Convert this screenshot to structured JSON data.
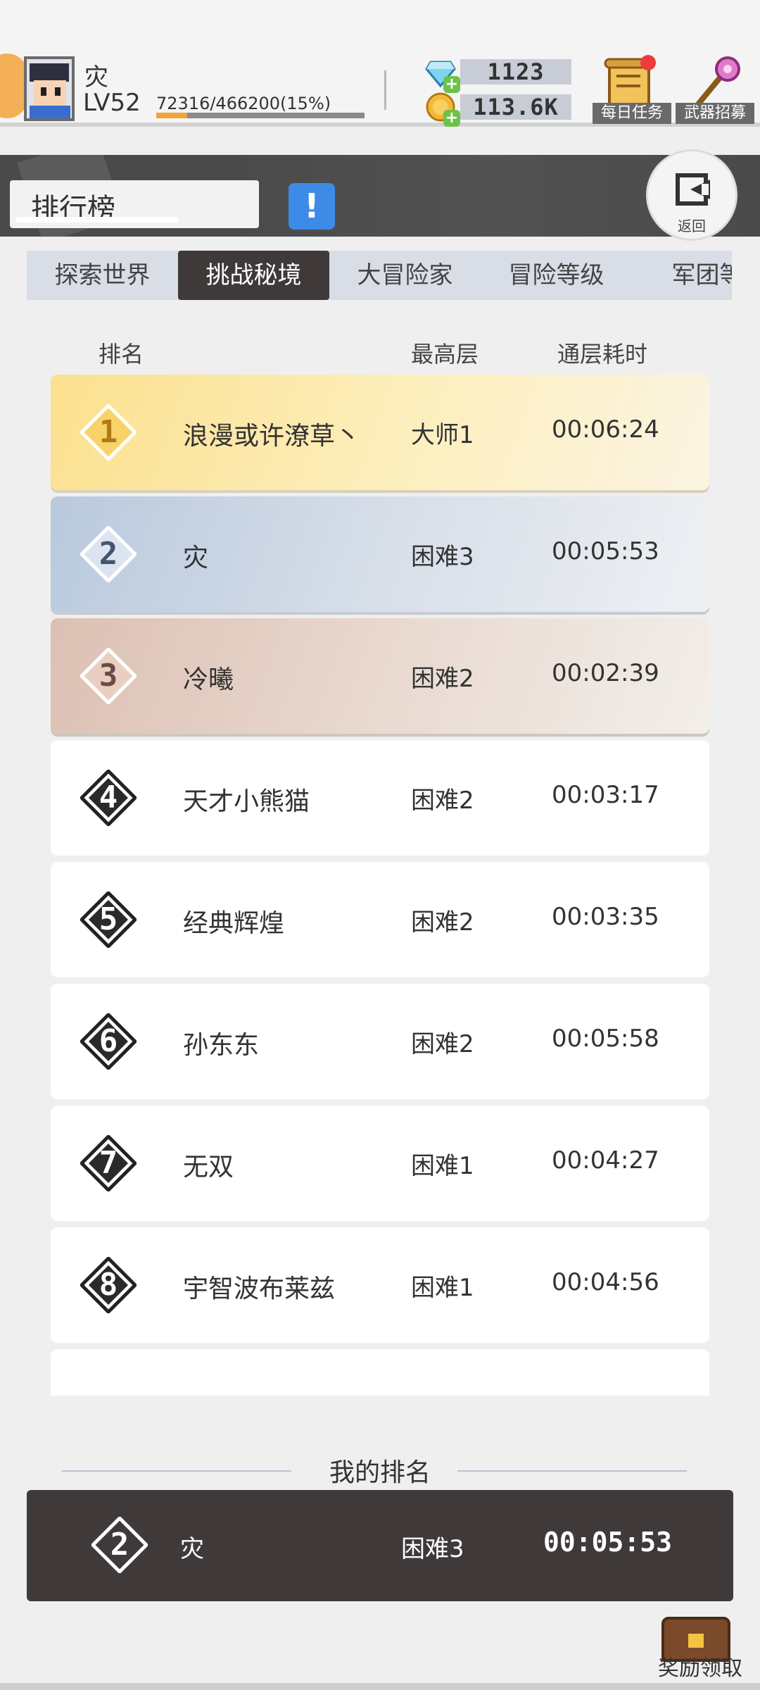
{
  "player": {
    "name": "灾",
    "level": "LV52",
    "xp_text": "72316/466200(15%)",
    "xp_progress": 0.15
  },
  "currency": {
    "gems": "1123",
    "coins": "113.6K"
  },
  "top_buttons": {
    "daily_tasks": "每日任务",
    "weapon_recruit": "武器招募"
  },
  "header": {
    "title": "排行榜",
    "info_symbol": "!",
    "back_label": "返回"
  },
  "tabs": [
    {
      "label": "探索世界",
      "active": false
    },
    {
      "label": "挑战秘境",
      "active": true
    },
    {
      "label": "大冒险家",
      "active": false
    },
    {
      "label": "冒险等级",
      "active": false
    },
    {
      "label": "军团等",
      "active": false
    }
  ],
  "columns": {
    "rank": "排名",
    "top_floor": "最高层",
    "clear_time": "通层耗时"
  },
  "leaderboard": [
    {
      "rank": "1",
      "name": "浪漫或许潦草丶",
      "tier": "大师1",
      "time": "00:06:24"
    },
    {
      "rank": "2",
      "name": "灾",
      "tier": "困难3",
      "time": "00:05:53"
    },
    {
      "rank": "3",
      "name": "冷曦",
      "tier": "困难2",
      "time": "00:02:39"
    },
    {
      "rank": "4",
      "name": "天才小熊猫",
      "tier": "困难2",
      "time": "00:03:17"
    },
    {
      "rank": "5",
      "name": "经典辉煌",
      "tier": "困难2",
      "time": "00:03:35"
    },
    {
      "rank": "6",
      "name": "孙东东",
      "tier": "困难2",
      "time": "00:05:58"
    },
    {
      "rank": "7",
      "name": "无双",
      "tier": "困难1",
      "time": "00:04:27"
    },
    {
      "rank": "8",
      "name": "宇智波布莱兹",
      "tier": "困难1",
      "time": "00:04:56"
    }
  ],
  "my_rank": {
    "label": "我的排名",
    "rank": "2",
    "name": "灾",
    "tier": "困难3",
    "time": "00:05:53"
  },
  "reward": {
    "label": "奖励领取"
  },
  "colors": {
    "accent_orange": "#f5a23a",
    "info_blue": "#3d8be6",
    "dark_panel": "#3f3939",
    "gold": "#fbe08e",
    "silver": "#b9c9dd",
    "bronze": "#dcc0b3",
    "badge_red": "#ef3b3b"
  }
}
